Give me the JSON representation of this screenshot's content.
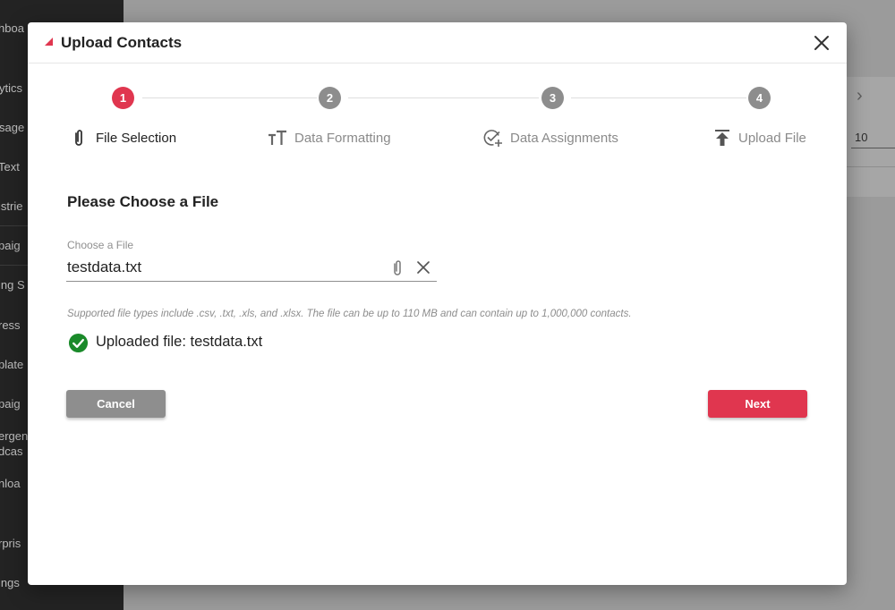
{
  "background": {
    "sidebar_items": [
      "hboa",
      "ytics",
      "sage",
      "Text",
      "istrie",
      "paig",
      "ing S",
      "ress",
      "plate",
      "paig",
      "ergen",
      "dcas",
      "nloa",
      "rpris",
      "ings"
    ],
    "panel_value": "10"
  },
  "modal": {
    "title": "Upload Contacts",
    "accent_color": "#e0364f",
    "steps": [
      {
        "number": "1",
        "label": "File Selection",
        "icon": "paperclip-icon",
        "active": true
      },
      {
        "number": "2",
        "label": "Data Formatting",
        "icon": "text-size-icon",
        "active": false
      },
      {
        "number": "3",
        "label": "Data Assignments",
        "icon": "check-circle-plus-icon",
        "active": false
      },
      {
        "number": "4",
        "label": "Upload File",
        "icon": "upload-icon",
        "active": false
      }
    ],
    "section_title": "Please Choose a File",
    "file_field": {
      "label": "Choose a File",
      "value": "testdata.txt"
    },
    "helper_text": "Supported file types include .csv, .txt, .xls, and .xlsx. The file can be up to 110 MB and can contain up to 1,000,000 contacts.",
    "success_message": "Uploaded file: testdata.txt",
    "success_color": "#1a8a2a",
    "buttons": {
      "cancel": "Cancel",
      "next": "Next"
    }
  }
}
